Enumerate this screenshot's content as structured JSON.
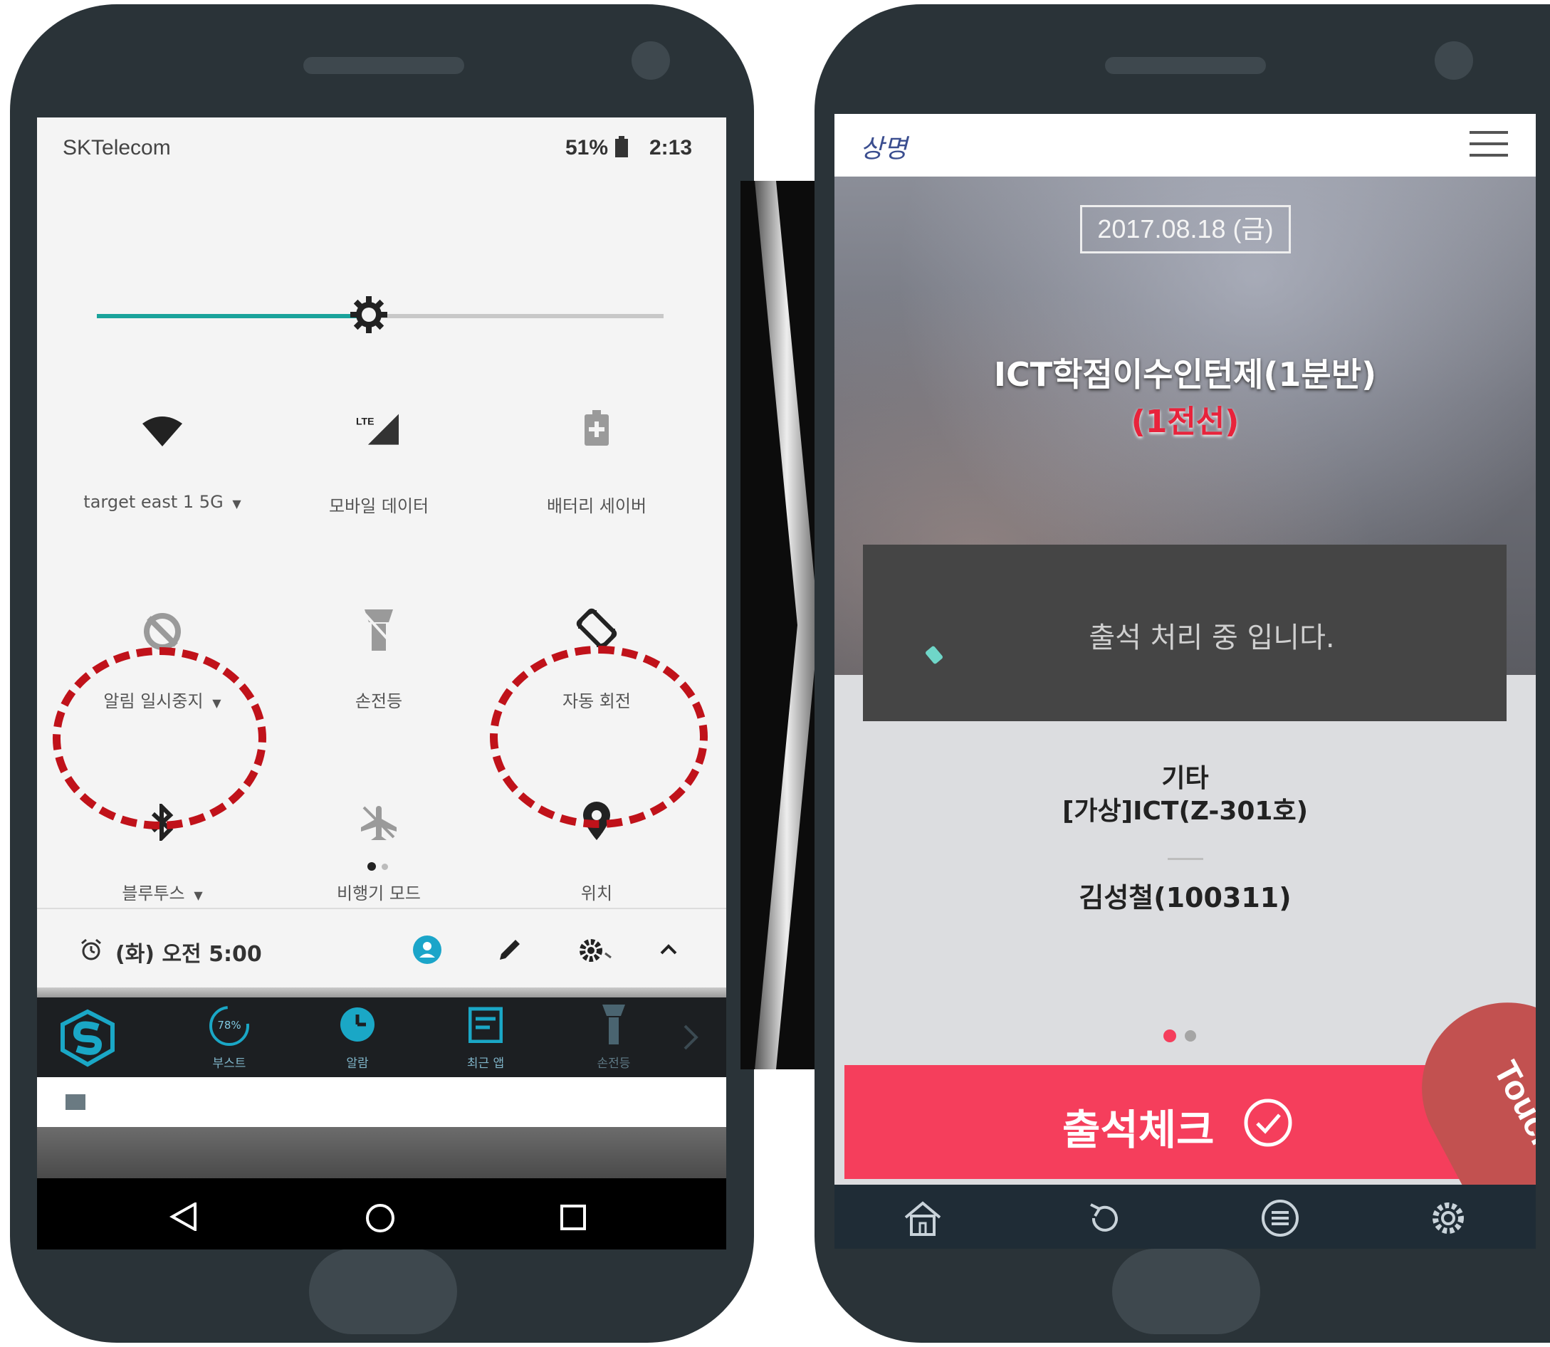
{
  "left_phone": {
    "status_bar": {
      "carrier": "SKTelecom",
      "battery": "51%",
      "time": "2:13"
    },
    "brightness": {
      "level_fraction": 0.48
    },
    "quick_settings": [
      {
        "label": "target east 1 5G",
        "icon": "wifi-icon",
        "dropdown": true
      },
      {
        "label": "모바일 데이터",
        "icon": "mobile-data-icon",
        "badge": "LTE",
        "dropdown": false
      },
      {
        "label": "배터리 세이버",
        "icon": "battery-saver-icon",
        "dropdown": false
      },
      {
        "label": "알림 일시중지",
        "icon": "do-not-disturb-icon",
        "dropdown": true
      },
      {
        "label": "손전등",
        "icon": "flashlight-icon",
        "dropdown": false
      },
      {
        "label": "자동 회전",
        "icon": "auto-rotate-icon",
        "dropdown": false
      },
      {
        "label": "블루투스",
        "icon": "bluetooth-icon",
        "dropdown": true
      },
      {
        "label": "비행기 모드",
        "icon": "airplane-mode-icon",
        "dropdown": false
      },
      {
        "label": "위치",
        "icon": "location-icon",
        "dropdown": false
      }
    ],
    "page_dots": {
      "count": 2,
      "active": 0
    },
    "footer": {
      "alarm": "(화) 오전 5:00"
    },
    "dock": {
      "items": [
        {
          "label": "",
          "icon": "app-s-logo-icon"
        },
        {
          "label": "부스트",
          "icon": "boost-gauge-icon",
          "badge": "78%"
        },
        {
          "label": "알람",
          "icon": "alarm-clock-icon"
        },
        {
          "label": "최근 앱",
          "icon": "recent-apps-icon"
        },
        {
          "label": "손전등",
          "icon": "dock-flashlight-icon"
        }
      ]
    },
    "nav_bar": [
      "back-icon",
      "home-icon",
      "recents-icon"
    ]
  },
  "right_phone": {
    "header": {
      "logo": "상명"
    },
    "date_box": "2017.08.18 (금)",
    "course_title": "ICT학점이수인턴제(1분반)",
    "course_subtitle": "(1전선)",
    "processing_message": "출석 처리 중 입니다.",
    "info": {
      "category": "기타",
      "room": "[가상]ICT(Z-301호)",
      "student": "김성철(100311)"
    },
    "page_dots": {
      "count": 2,
      "active": 0
    },
    "attendance_button": "출석체크",
    "touch_tag": "Touch",
    "bottom_nav": [
      "home-icon",
      "refresh-icon",
      "list-icon",
      "settings-icon"
    ]
  },
  "colors": {
    "phone_body": "#2a3338",
    "accent_teal": "#1aa39b",
    "dashed_circle": "#c0121a",
    "attendance_button": "#f53e5c",
    "touch_tag": "#c25150",
    "bottom_nav": "#1f2c36",
    "subtitle_red": "#e8233b",
    "processing_box": "#454545"
  }
}
